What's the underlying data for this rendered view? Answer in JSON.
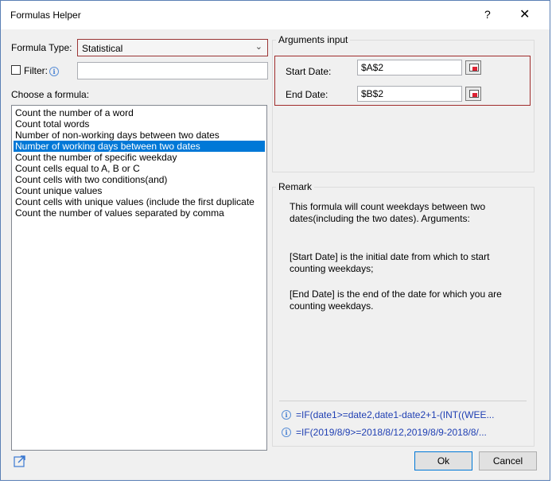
{
  "window": {
    "title": "Formulas Helper",
    "help_glyph": "?",
    "close_glyph": "✕"
  },
  "formula_type": {
    "label": "Formula Type:",
    "value": "Statistical"
  },
  "filter": {
    "label": "Filter:",
    "checked": false,
    "value": ""
  },
  "choose": {
    "label": "Choose a formula:",
    "items": [
      "Count the number of a word",
      "Count total words",
      "Number of non-working days between two dates",
      "Number of working days between two dates",
      "Count the number of specific weekday",
      "Count cells equal to A, B or C",
      "Count cells with two conditions(and)",
      "Count unique values",
      "Count cells with unique values (include the first duplicate",
      "Count the number of values separated by comma"
    ],
    "selected_item": "Number of working days between two dates"
  },
  "arguments": {
    "title": "Arguments input",
    "start_label": "Start Date:",
    "start_value": "$A$2",
    "end_label": "End Date:",
    "end_value": "$B$2"
  },
  "remark": {
    "title": "Remark",
    "text1_line1": "This formula will count weekdays between two",
    "text1_line2": "dates(including the two dates). Arguments:",
    "text2_line1": "[Start Date] is the initial date from which to start",
    "text2_line2": "counting weekdays;",
    "text3_line1": "[End Date] is the end of the date for which you are",
    "text3_line2": "counting weekdays.",
    "formula1": "=IF(date1>=date2,date1-date2+1-(INT((WEE...",
    "formula2": "=IF(2019/8/9>=2018/8/12,2019/8/9-2018/8/..."
  },
  "buttons": {
    "ok": "Ok",
    "cancel": "Cancel"
  },
  "colors": {
    "selection": "#0078d7",
    "highlight_frame": "#a02c2c",
    "formula_text": "#1f3fb3",
    "info_icon": "#3a78d1"
  }
}
